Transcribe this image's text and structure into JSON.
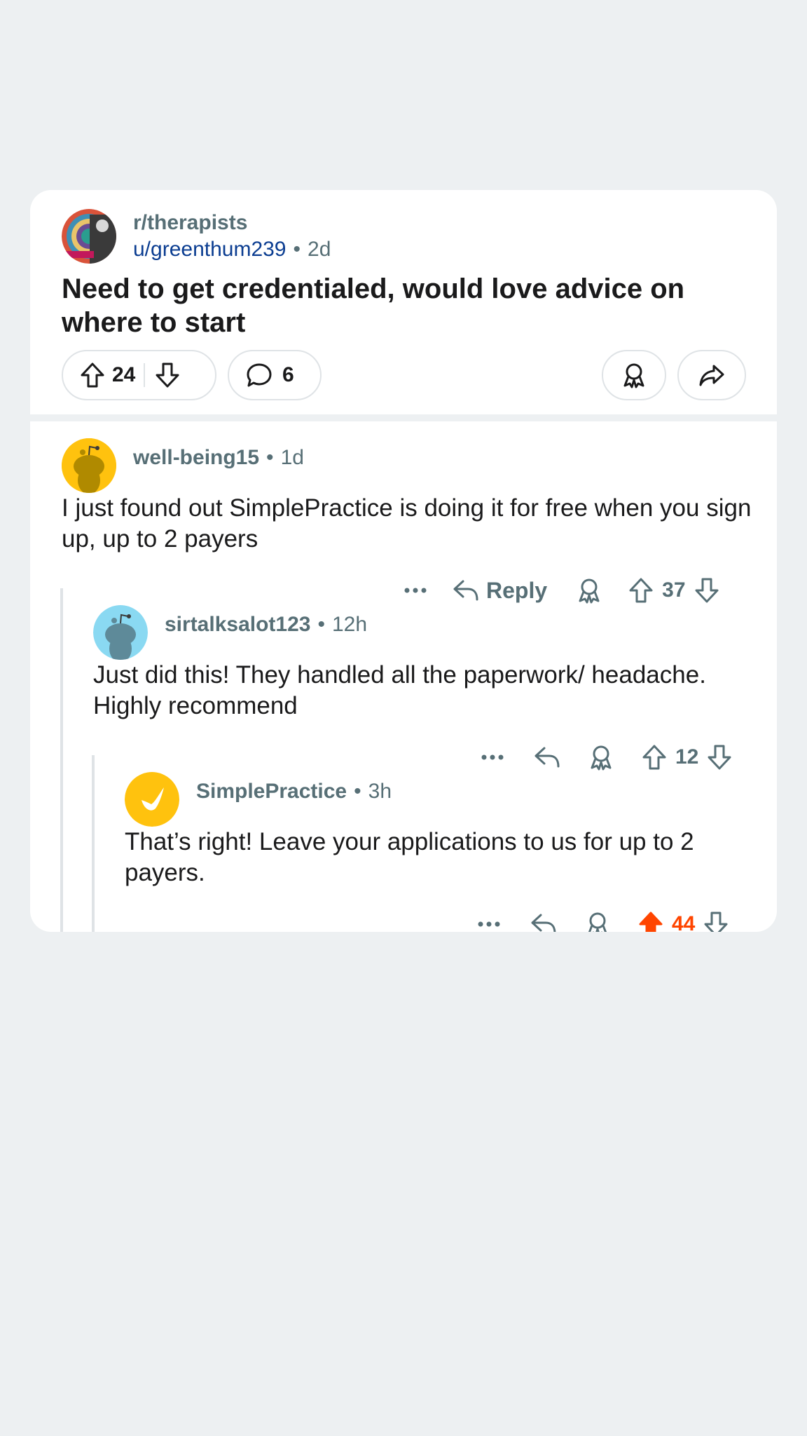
{
  "post": {
    "subreddit": "r/therapists",
    "author": "u/greenthum239",
    "age": "2d",
    "separator": "•",
    "title": "Need to get credentialed, would love advice on where to start",
    "votes": "24",
    "comments": "6"
  },
  "comments": [
    {
      "author": "well-being15",
      "age": "1d",
      "body": "I just found out SimplePractice is doing it for free when you sign up, up to 2 payers",
      "reply_label": "Reply",
      "score": "37",
      "avatar_color": "#ffc20e"
    },
    {
      "author": "sirtalksalot123",
      "age": "12h",
      "body": "Just did this! They handled all the paperwork/ headache. Highly recommend",
      "score": "12",
      "avatar_color": "#8ad9f2"
    },
    {
      "author": "SimplePractice",
      "age": "3h",
      "body": "That’s right! Leave your applications to us for up to 2 payers.",
      "score": "44",
      "upvoted": true,
      "avatar_color": "#ffc20e"
    }
  ],
  "colors": {
    "upvote_active": "#ff4500",
    "meta_text": "#576f76",
    "user_link": "#0b3d91"
  }
}
